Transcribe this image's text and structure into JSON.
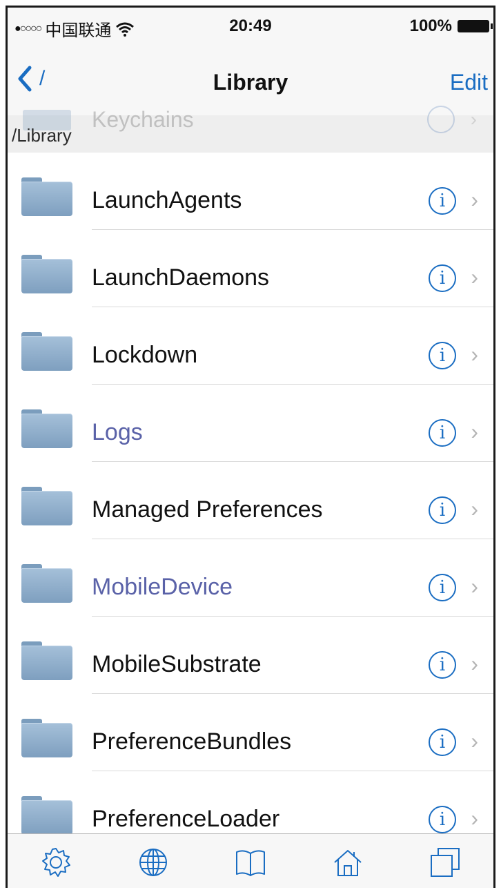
{
  "status_bar": {
    "signal": "●○○○○",
    "carrier": "中国联通",
    "time": "20:49",
    "battery_percent": "100%",
    "icons": [
      "wifi-icon",
      "battery-icon"
    ]
  },
  "nav_bar": {
    "back_label": "/",
    "title": "Library",
    "edit_label": "Edit"
  },
  "path_bar": {
    "path": "/Library",
    "partially_hidden_row": "Keychains"
  },
  "files": [
    {
      "name": "LaunchAgents",
      "style": "normal"
    },
    {
      "name": "LaunchDaemons",
      "style": "normal"
    },
    {
      "name": "Lockdown",
      "style": "normal"
    },
    {
      "name": "Logs",
      "style": "link"
    },
    {
      "name": "Managed Preferences",
      "style": "normal"
    },
    {
      "name": "MobileDevice",
      "style": "link"
    },
    {
      "name": "MobileSubstrate",
      "style": "normal"
    },
    {
      "name": "PreferenceBundles",
      "style": "normal"
    },
    {
      "name": "PreferenceLoader",
      "style": "normal"
    }
  ],
  "row_glyphs": {
    "info": "i",
    "chevron": "›"
  },
  "tab_bar": {
    "items": [
      "gear-icon",
      "globe-icon",
      "book-icon",
      "home-icon",
      "windows-icon"
    ]
  },
  "colors": {
    "accent": "#1a6dc2",
    "link_text": "#5a62a8",
    "folder": "#8fb0cf"
  }
}
